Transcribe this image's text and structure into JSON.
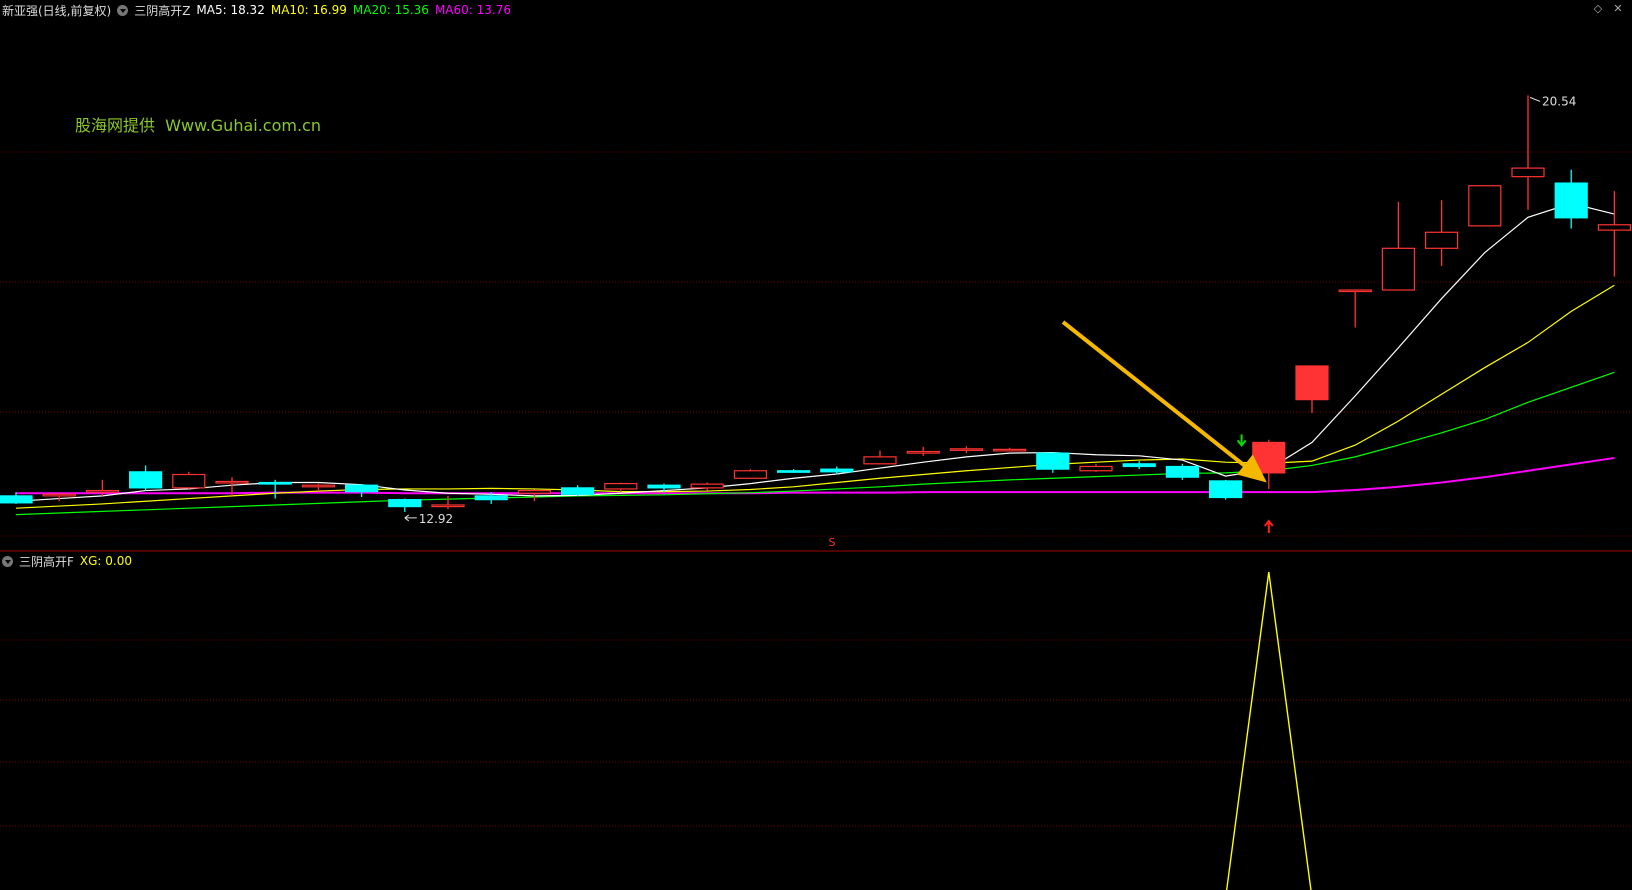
{
  "main_panel": {
    "stock_title": "新亚强(日线,前复权)",
    "indicator_name": "三阴高开Z",
    "ma": [
      {
        "label": "MA5: 18.32",
        "color": "#ffffff"
      },
      {
        "label": "MA10: 16.99",
        "color": "#ffff00"
      },
      {
        "label": "MA20: 15.36",
        "color": "#00ff00"
      },
      {
        "label": "MA60: 13.76",
        "color": "#ff00ff"
      }
    ],
    "watermark": "股海网提供  Www.Guhai.com.cn",
    "high_label": "20.54",
    "low_label": "12.92",
    "signal_s": "S"
  },
  "sub_panel": {
    "indicator_name": "三阴高开F",
    "value_label": "XG: 0.00"
  },
  "colors": {
    "up": "#ff3333",
    "down": "#00ffff",
    "ma5": "#ffffff",
    "ma10": "#ffff00",
    "ma20": "#00ff00",
    "ma60": "#ff00ff",
    "arrow": "#f5b800",
    "grid": "#7a0000",
    "xg": "#ffff00"
  },
  "chart_data": {
    "type": "candlestick",
    "candles": [
      {
        "o": 13.05,
        "h": 13.12,
        "l": 12.9,
        "c": 12.92
      },
      {
        "o": 13.05,
        "h": 13.1,
        "l": 12.95,
        "c": 13.08
      },
      {
        "o": 13.12,
        "h": 13.35,
        "l": 13.05,
        "c": 13.15
      },
      {
        "o": 13.5,
        "h": 13.62,
        "l": 13.15,
        "c": 13.2
      },
      {
        "o": 13.2,
        "h": 13.5,
        "l": 13.18,
        "c": 13.45
      },
      {
        "o": 13.3,
        "h": 13.4,
        "l": 13.05,
        "c": 13.32
      },
      {
        "o": 13.3,
        "h": 13.35,
        "l": 13.0,
        "c": 13.28
      },
      {
        "o": 13.22,
        "h": 13.28,
        "l": 13.14,
        "c": 13.25
      },
      {
        "o": 13.25,
        "h": 13.27,
        "l": 13.03,
        "c": 13.13
      },
      {
        "o": 12.98,
        "h": 13.0,
        "l": 12.75,
        "c": 12.85
      },
      {
        "o": 12.85,
        "h": 13.05,
        "l": 12.8,
        "c": 12.88
      },
      {
        "o": 13.05,
        "h": 13.12,
        "l": 12.9,
        "c": 12.98
      },
      {
        "o": 13.1,
        "h": 13.17,
        "l": 12.95,
        "c": 13.15
      },
      {
        "o": 13.2,
        "h": 13.25,
        "l": 13.05,
        "c": 13.08
      },
      {
        "o": 13.18,
        "h": 13.3,
        "l": 13.12,
        "c": 13.28
      },
      {
        "o": 13.25,
        "h": 13.28,
        "l": 13.12,
        "c": 13.2
      },
      {
        "o": 13.2,
        "h": 13.3,
        "l": 13.15,
        "c": 13.27
      },
      {
        "o": 13.38,
        "h": 13.55,
        "l": 13.38,
        "c": 13.52
      },
      {
        "o": 13.52,
        "h": 13.55,
        "l": 13.48,
        "c": 13.5
      },
      {
        "o": 13.55,
        "h": 13.6,
        "l": 13.45,
        "c": 13.5
      },
      {
        "o": 13.65,
        "h": 13.9,
        "l": 13.65,
        "c": 13.78
      },
      {
        "o": 13.85,
        "h": 13.97,
        "l": 13.8,
        "c": 13.88
      },
      {
        "o": 13.93,
        "h": 13.98,
        "l": 13.85,
        "c": 13.93
      },
      {
        "o": 13.92,
        "h": 13.95,
        "l": 13.9,
        "c": 13.92
      },
      {
        "o": 13.85,
        "h": 13.85,
        "l": 13.48,
        "c": 13.55
      },
      {
        "o": 13.52,
        "h": 13.65,
        "l": 13.5,
        "c": 13.6
      },
      {
        "o": 13.65,
        "h": 13.7,
        "l": 13.55,
        "c": 13.6
      },
      {
        "o": 13.6,
        "h": 13.65,
        "l": 13.35,
        "c": 13.4
      },
      {
        "o": 13.33,
        "h": 13.35,
        "l": 12.98,
        "c": 13.02
      },
      {
        "o": 13.48,
        "h": 14.1,
        "l": 13.18,
        "c": 14.05
      },
      {
        "o": 14.85,
        "h": 15.48,
        "l": 14.6,
        "c": 15.48
      },
      {
        "o": 16.9,
        "h": 16.9,
        "l": 16.2,
        "c": 16.9
      },
      {
        "o": 16.9,
        "h": 18.55,
        "l": 16.9,
        "c": 17.68
      },
      {
        "o": 17.68,
        "h": 18.58,
        "l": 17.35,
        "c": 17.98
      },
      {
        "o": 18.1,
        "h": 18.82,
        "l": 18.1,
        "c": 18.85
      },
      {
        "o": 19.02,
        "h": 20.54,
        "l": 18.4,
        "c": 19.18
      },
      {
        "o": 18.9,
        "h": 19.15,
        "l": 18.05,
        "c": 18.25
      },
      {
        "o": 18.02,
        "h": 18.75,
        "l": 17.15,
        "c": 18.12
      }
    ],
    "ma5": [
      12.95,
      13.0,
      13.05,
      13.15,
      13.18,
      13.25,
      13.3,
      13.3,
      13.26,
      13.16,
      13.1,
      13.08,
      13.05,
      13.06,
      13.1,
      13.15,
      13.2,
      13.28,
      13.38,
      13.46,
      13.57,
      13.68,
      13.78,
      13.85,
      13.86,
      13.82,
      13.8,
      13.72,
      13.42,
      13.55,
      14.05,
      14.92,
      15.82,
      16.74,
      17.6,
      18.26,
      18.52,
      18.32
    ],
    "ma10": [
      12.82,
      12.86,
      12.9,
      12.95,
      13.0,
      13.05,
      13.1,
      13.14,
      13.17,
      13.18,
      13.18,
      13.19,
      13.18,
      13.16,
      13.13,
      13.13,
      13.14,
      13.17,
      13.22,
      13.3,
      13.38,
      13.45,
      13.52,
      13.58,
      13.64,
      13.68,
      13.72,
      13.74,
      13.68,
      13.66,
      13.7,
      14.0,
      14.45,
      14.95,
      15.45,
      15.92,
      16.5,
      16.99
    ],
    "ma20": [
      12.7,
      12.73,
      12.76,
      12.79,
      12.82,
      12.85,
      12.88,
      12.91,
      12.94,
      12.97,
      12.99,
      13.01,
      13.03,
      13.05,
      13.06,
      13.07,
      13.09,
      13.11,
      13.14,
      13.18,
      13.22,
      13.27,
      13.31,
      13.35,
      13.38,
      13.41,
      13.44,
      13.47,
      13.48,
      13.52,
      13.62,
      13.78,
      14.0,
      14.23,
      14.48,
      14.8,
      15.08,
      15.36
    ],
    "ma60": [
      13.1,
      13.1,
      13.1,
      13.1,
      13.1,
      13.1,
      13.11,
      13.11,
      13.11,
      13.1,
      13.1,
      13.1,
      13.1,
      13.1,
      13.1,
      13.1,
      13.1,
      13.1,
      13.11,
      13.11,
      13.11,
      13.12,
      13.12,
      13.12,
      13.12,
      13.12,
      13.12,
      13.12,
      13.12,
      13.12,
      13.12,
      13.16,
      13.22,
      13.3,
      13.4,
      13.52,
      13.64,
      13.76
    ],
    "xg": [
      0,
      0,
      0,
      0,
      0,
      0,
      0,
      0,
      0,
      0,
      0,
      0,
      0,
      0,
      0,
      0,
      0,
      0,
      0,
      0,
      0,
      0,
      0,
      0,
      0,
      0,
      0,
      0,
      0,
      1,
      0,
      0,
      0,
      0,
      0,
      0,
      0,
      0
    ],
    "signal_index": 29,
    "high_index": 35,
    "low_index": 9
  }
}
